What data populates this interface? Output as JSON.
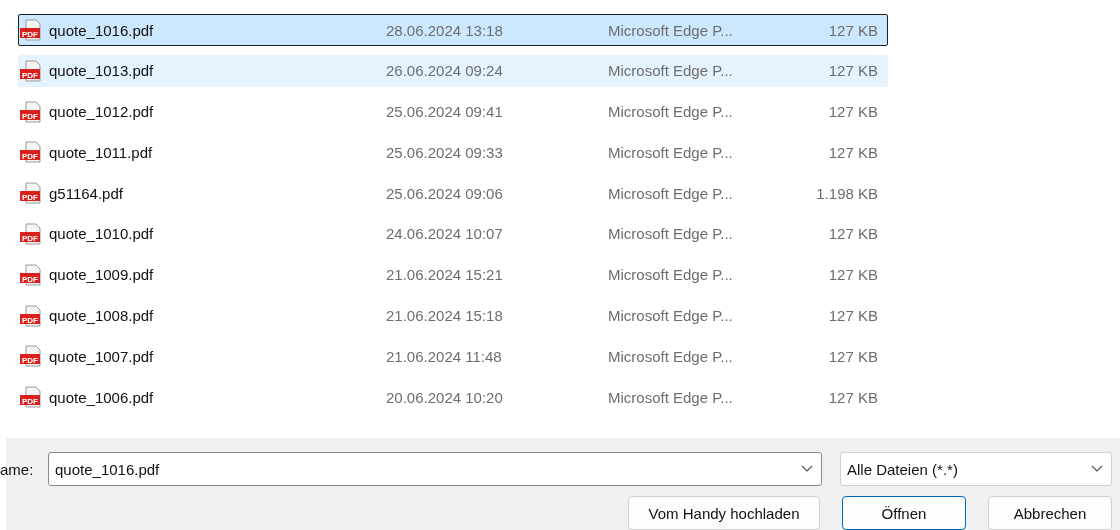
{
  "files": [
    {
      "icon": "PDF",
      "name": "quote_1016.pdf",
      "date": "28.06.2024 13:18",
      "type": "Microsoft Edge P...",
      "size": "127 KB",
      "selected": true,
      "hovered": false
    },
    {
      "icon": "PDF",
      "name": "quote_1013.pdf",
      "date": "26.06.2024 09:24",
      "type": "Microsoft Edge P...",
      "size": "127 KB",
      "selected": false,
      "hovered": true
    },
    {
      "icon": "PDF",
      "name": "quote_1012.pdf",
      "date": "25.06.2024 09:41",
      "type": "Microsoft Edge P...",
      "size": "127 KB",
      "selected": false,
      "hovered": false
    },
    {
      "icon": "PDF",
      "name": "quote_1011.pdf",
      "date": "25.06.2024 09:33",
      "type": "Microsoft Edge P...",
      "size": "127 KB",
      "selected": false,
      "hovered": false
    },
    {
      "icon": "PDF",
      "name": "g51164.pdf",
      "date": "25.06.2024 09:06",
      "type": "Microsoft Edge P...",
      "size": "1.198 KB",
      "selected": false,
      "hovered": false
    },
    {
      "icon": "PDF",
      "name": "quote_1010.pdf",
      "date": "24.06.2024 10:07",
      "type": "Microsoft Edge P...",
      "size": "127 KB",
      "selected": false,
      "hovered": false
    },
    {
      "icon": "PDF",
      "name": "quote_1009.pdf",
      "date": "21.06.2024 15:21",
      "type": "Microsoft Edge P...",
      "size": "127 KB",
      "selected": false,
      "hovered": false
    },
    {
      "icon": "PDF",
      "name": "quote_1008.pdf",
      "date": "21.06.2024 15:18",
      "type": "Microsoft Edge P...",
      "size": "127 KB",
      "selected": false,
      "hovered": false
    },
    {
      "icon": "PDF",
      "name": "quote_1007.pdf",
      "date": "21.06.2024 11:48",
      "type": "Microsoft Edge P...",
      "size": "127 KB",
      "selected": false,
      "hovered": false
    },
    {
      "icon": "PDF",
      "name": "quote_1006.pdf",
      "date": "20.06.2024 10:20",
      "type": "Microsoft Edge P...",
      "size": "127 KB",
      "selected": false,
      "hovered": false
    }
  ],
  "filename": {
    "label": "ame:",
    "value": "quote_1016.pdf"
  },
  "filter": {
    "value": "Alle Dateien (*.*)"
  },
  "buttons": [
    {
      "label": "Vom Handy hochladen",
      "default": false
    },
    {
      "label": "Öffnen",
      "default": true
    },
    {
      "label": "Abbrechen",
      "default": false
    }
  ]
}
